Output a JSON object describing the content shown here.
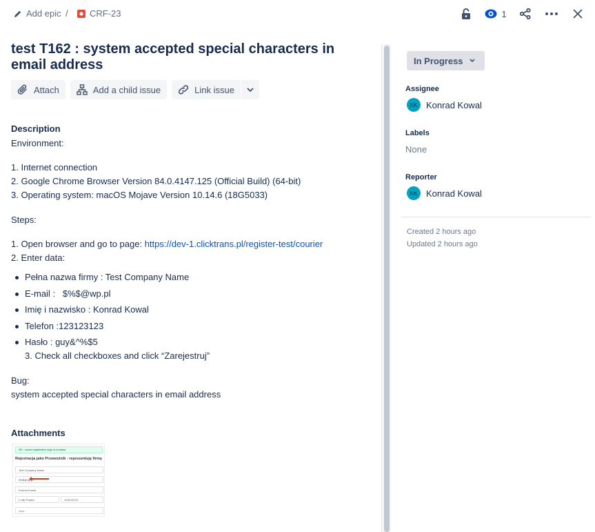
{
  "breadcrumb": {
    "epic_label": "Add epic",
    "separator": "/",
    "issue_key": "CRF-23"
  },
  "toolbar": {
    "watch_count": "1",
    "icons": [
      "lock-icon",
      "eye-icon",
      "share-icon",
      "more-icon",
      "close-icon"
    ]
  },
  "issue": {
    "title": "test T162 : system accepted special characters in email address"
  },
  "actions": {
    "attach": "Attach",
    "add_child": "Add a child issue",
    "link_issue": "Link issue"
  },
  "description": {
    "heading": "Description",
    "environment_label": "Environment:",
    "env_items": [
      "1. Internet connection",
      "2. Google Chrome Browser Version 84.0.4147.125 (Official Build) (64-bit)",
      "3. Operating system: macOS Mojave Version 10.14.6 (18G5033)"
    ],
    "steps_label": "Steps:",
    "step1_prefix": "1. Open browser and go to page: ",
    "step1_link": "https://dev-1.clicktrans.pl/register-test/courier",
    "step2": "2. Enter data:",
    "data_items": [
      "Pełna nazwa firmy : Test Company Name",
      "E-mail :   $%$@wp.pl",
      "Imię i nazwisko : Konrad Kowal",
      "Telefon :123123123",
      "Hasło : guy&^%$5"
    ],
    "step3": "3. Check all checkboxes and click “Zarejestruj”",
    "bug_label": "Bug:",
    "bug_text": "system accepted special characters in email address"
  },
  "attachments": {
    "heading": "Attachments",
    "thumbnail": {
      "alert": "OK - some registration logic is invoked",
      "title": "Rejestracja jako Przewoźnik - reprezentuję firmę",
      "fields": [
        "Test Company Name",
        "$%$@wp.pl",
        "Konrad Kowal",
        "(+48) Polska",
        "123123123",
        "••••••"
      ]
    }
  },
  "sidebar": {
    "status": "In Progress",
    "assignee_label": "Assignee",
    "assignee_initials": "KK",
    "assignee_name": "Konrad Kowal",
    "labels_label": "Labels",
    "labels_value": "None",
    "reporter_label": "Reporter",
    "reporter_initials": "KK",
    "reporter_name": "Konrad Kowal",
    "created": "Created 2 hours ago",
    "updated": "Updated 2 hours ago"
  },
  "colors": {
    "link": "#0052cc",
    "avatar": "#00a3bf",
    "issue_type": "#e5493a",
    "status_bg": "#dfe1e6"
  }
}
